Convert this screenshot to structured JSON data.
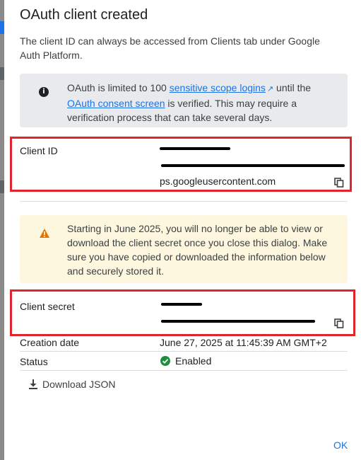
{
  "dialog": {
    "title": "OAuth client created",
    "subtitle": "The client ID can always be accessed from Clients tab under Google Auth Platform."
  },
  "info": {
    "icon": "info-icon",
    "text_before": "OAuth is limited to 100 ",
    "link1": "sensitive scope logins",
    "text_middle": " until the ",
    "link2": "OAuth consent screen",
    "text_after": " is verified. This may require a verification process that can take several days."
  },
  "client_id": {
    "label": "Client ID",
    "value_visible": "ps.googleusercontent.com"
  },
  "warning": {
    "icon": "warning-icon",
    "text": "Starting in June 2025, you will no longer be able to view or download the client secret once you close this dialog. Make sure you have copied or downloaded the information below and securely stored it."
  },
  "client_secret": {
    "label": "Client secret"
  },
  "creation": {
    "label": "Creation date",
    "value": "June 27, 2025 at 11:45:39 AM GMT+2"
  },
  "status": {
    "label": "Status",
    "value": "Enabled"
  },
  "actions": {
    "download_label": "Download JSON",
    "ok_label": "OK"
  },
  "colors": {
    "accent": "#1a73e8",
    "highlight": "#e0242b",
    "status_ok": "#1e8e3e",
    "warning": "#e37400"
  }
}
